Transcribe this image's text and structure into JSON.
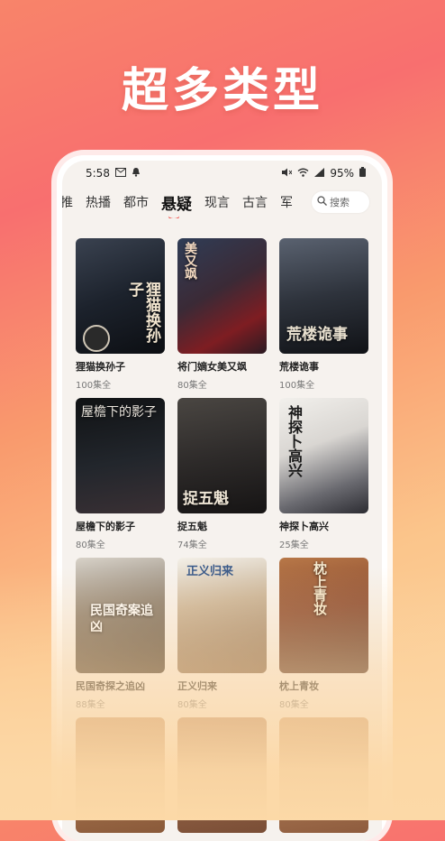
{
  "hero": {
    "title": "超多类型"
  },
  "status_bar": {
    "time": "5:58",
    "battery": "95%"
  },
  "tabs": [
    {
      "label": "推"
    },
    {
      "label": "热播"
    },
    {
      "label": "都市"
    },
    {
      "label": "悬疑",
      "active": true
    },
    {
      "label": "现言"
    },
    {
      "label": "古言"
    },
    {
      "label": "军"
    }
  ],
  "search": {
    "label": "搜索"
  },
  "dramas": [
    {
      "title": "狸猫换孙子",
      "episodes": "100集全",
      "poster_text": "狸猫换孙子"
    },
    {
      "title": "将门嫡女美又飒",
      "episodes": "80集全",
      "poster_text": "美又飒"
    },
    {
      "title": "荒楼诡事",
      "episodes": "100集全",
      "poster_text": "荒楼诡事"
    },
    {
      "title": "屋檐下的影子",
      "episodes": "80集全",
      "poster_text": "屋檐下的影子"
    },
    {
      "title": "捉五魁",
      "episodes": "74集全",
      "poster_text": "捉五魁"
    },
    {
      "title": "神探卜高兴",
      "episodes": "25集全",
      "poster_text": "神探卜高兴"
    },
    {
      "title": "民国奇探之追凶",
      "episodes": "88集全",
      "poster_text": "民国奇案追凶"
    },
    {
      "title": "正义归来",
      "episodes": "80集全",
      "poster_text": "正义归来"
    },
    {
      "title": "枕上青妆",
      "episodes": "80集全",
      "poster_text": "枕上青妆"
    },
    {
      "title": "",
      "episodes": "",
      "poster_text": ""
    },
    {
      "title": "",
      "episodes": "",
      "poster_text": ""
    },
    {
      "title": "",
      "episodes": "",
      "poster_text": ""
    }
  ],
  "colors": {
    "accent": "#f0453e",
    "tab_indicator": "#f0453e"
  }
}
